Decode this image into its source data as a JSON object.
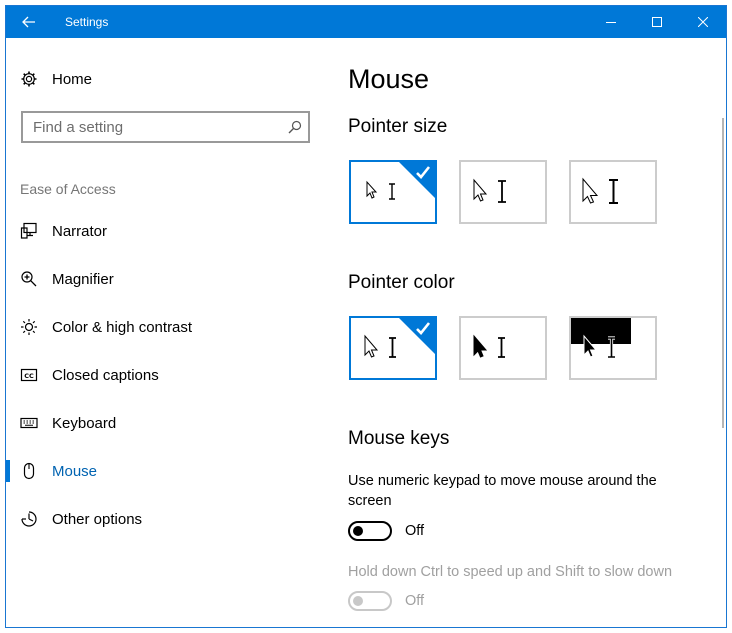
{
  "window": {
    "title": "Settings"
  },
  "sidebar": {
    "home_label": "Home",
    "search_placeholder": "Find a setting",
    "section_label": "Ease of Access",
    "items": [
      {
        "label": "Narrator",
        "icon": "narrator-icon"
      },
      {
        "label": "Magnifier",
        "icon": "magnifier-icon"
      },
      {
        "label": "Color & high contrast",
        "icon": "brightness-icon"
      },
      {
        "label": "Closed captions",
        "icon": "closed-captions-icon"
      },
      {
        "label": "Keyboard",
        "icon": "keyboard-icon"
      },
      {
        "label": "Mouse",
        "icon": "mouse-icon",
        "active": true
      },
      {
        "label": "Other options",
        "icon": "other-options-icon"
      }
    ]
  },
  "main": {
    "title": "Mouse",
    "pointer_size": {
      "heading": "Pointer size",
      "selected_index": 0
    },
    "pointer_color": {
      "heading": "Pointer color",
      "selected_index": 0,
      "options": [
        "white",
        "black",
        "inverted"
      ]
    },
    "mouse_keys": {
      "heading": "Mouse keys",
      "toggle1_description": "Use numeric keypad to move mouse around the screen",
      "toggle1_state": "Off",
      "toggle2_description": "Hold down Ctrl to speed up and Shift to slow down",
      "toggle2_state": "Off"
    }
  },
  "colors": {
    "accent": "#0078d7",
    "accent_text": "#0063b1",
    "disabled_text": "#a0a0a0",
    "tile_border": "#cccccc"
  }
}
